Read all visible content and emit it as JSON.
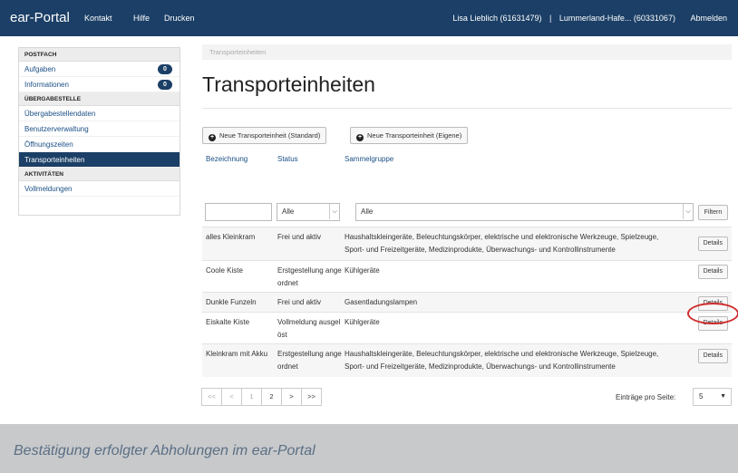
{
  "topbar": {
    "brand": "ear-Portal",
    "nav": [
      "Kontakt",
      "Hilfe",
      "Drucken"
    ],
    "user": "Lisa Lieblich (61631479)",
    "separator": "|",
    "org": "Lummerland-Hafe... (60331067)",
    "logout": "Abmelden"
  },
  "sidebar": {
    "postfach_label": "POSTFACH",
    "postfach_items": [
      {
        "label": "Aufgaben",
        "badge": "0"
      },
      {
        "label": "Informationen",
        "badge": "0"
      }
    ],
    "uebergabe_label": "ÜBERGABESTELLE",
    "uebergabe_items": [
      "Übergabestellendaten",
      "Benutzerverwaltung",
      "Öffnungszeiten",
      "Transporteinheiten"
    ],
    "aktiv_label": "AKTIVITÄTEN",
    "aktiv_items": [
      "Vollmeldungen"
    ]
  },
  "breadcrumb": "Transporteinheiten",
  "page_title": "Transporteinheiten",
  "buttons": {
    "new_standard": "Neue Transporteinheit (Standard)",
    "new_custom": "Neue Transporteinheit (Eigene)",
    "filter": "Filtern",
    "details": "Details"
  },
  "columns": {
    "name": "Bezeichnung",
    "status": "Status",
    "group": "Sammelgruppe"
  },
  "filters": {
    "name_value": "",
    "status_value": "Alle",
    "group_value": "Alle"
  },
  "rows": [
    {
      "name": "alles Kleinkram",
      "status": [
        "Frei und aktiv"
      ],
      "group": [
        "Haushaltskleingeräte, Beleuchtungskörper, elektrische und elektronische Werkzeuge, Spielzeuge,",
        "Sport- und Freizeitgeräte, Medizinprodukte, Überwachungs- und Kontrollinstrumente"
      ]
    },
    {
      "name": "Coole Kiste",
      "status": [
        "Erstgestellung ange",
        "ordnet"
      ],
      "group": [
        "Kühlgeräte"
      ]
    },
    {
      "name": "Dunkle Funzeln",
      "status": [
        "Frei und aktiv"
      ],
      "group": [
        "Gasentladungslampen"
      ]
    },
    {
      "name": "Eiskalte Kiste",
      "status": [
        "Vollmeldung ausgel",
        "öst"
      ],
      "group": [
        "Kühlgeräte"
      ]
    },
    {
      "name": "Kleinkram mit Akku",
      "status": [
        "Erstgestellung ange",
        "ordnet"
      ],
      "group": [
        "Haushaltskleingeräte, Beleuchtungskörper, elektrische und elektronische Werkzeuge, Spielzeuge,",
        "Sport- und Freizeitgeräte, Medizinprodukte, Überwachungs- und Kontrollinstrumente"
      ]
    }
  ],
  "pager": {
    "first": "<<",
    "prev": "<",
    "page1": "1",
    "page2": "2",
    "next": ">",
    "last": ">>",
    "per_page_label": "Einträge pro Seite:",
    "per_page_value": "5"
  },
  "caption": "Bestätigung erfolgter Abholungen im ear-Portal",
  "colors": {
    "navy": "#1b3f66",
    "highlight": "#d02b2b",
    "frame": "#c8c9cb"
  }
}
